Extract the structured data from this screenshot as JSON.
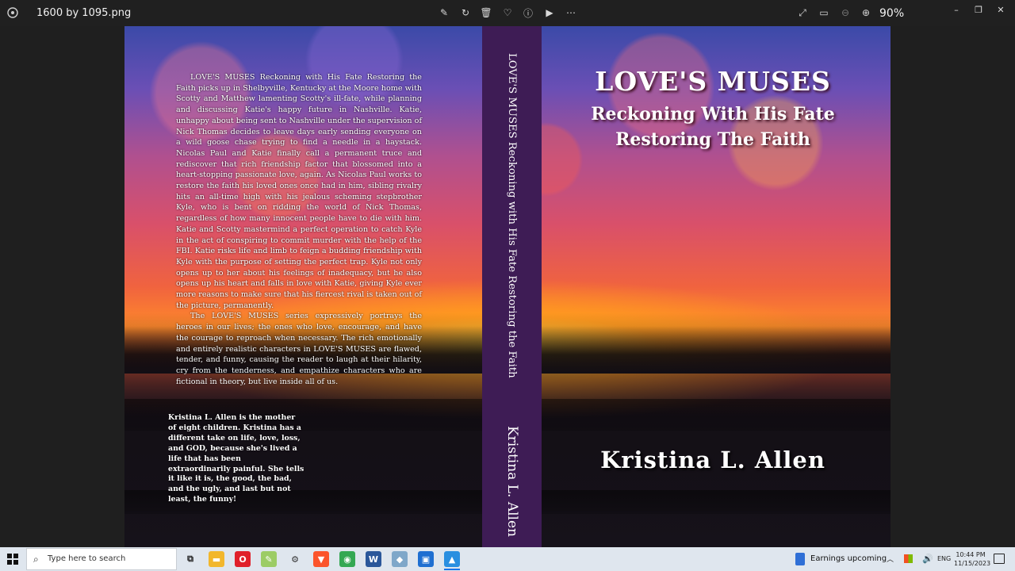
{
  "window": {
    "file_name": "1600  by  1095.png",
    "zoom_level": "90%",
    "toolbar_icons": [
      "edit-icon",
      "rotate-icon",
      "delete-icon",
      "favorite-icon",
      "info-icon",
      "slideshow-icon",
      "more-icon"
    ],
    "right_icons": [
      "fullscreen-icon",
      "fit-icon",
      "zoom-out-icon",
      "zoom-in-icon"
    ],
    "controls": {
      "minimize": "–",
      "restore": "❐",
      "close": "✕"
    }
  },
  "book": {
    "back_blurb": [
      "LOVE'S MUSES Reckoning with His Fate Restoring the Faith picks up in Shelbyville, Kentucky at the Moore home with Scotty and Matthew lamenting Scotty's ill-fate, while planning and discussing Katie's happy future in Nashville. Katie, unhappy about being sent to Nashville under the supervision of Nick Thomas decides to leave days early sending everyone on a wild goose chase trying to find a needle in a haystack. Nicolas Paul and Katie finally call a permanent truce and rediscover that rich friendship factor that blossomed into a heart-stopping passionate love, again. As Nicolas Paul works to restore the faith his loved ones once had in him, sibling rivalry hits an all-time high with his jealous scheming stepbrother Kyle, who is bent on ridding the world of Nick Thomas, regardless of how many innocent people have to die with him. Katie and Scotty mastermind a perfect operation to catch Kyle in the act of conspiring to commit murder with the help of the FBI. Katie risks life and limb to feign a budding friendship with Kyle with the purpose of setting the perfect trap. Kyle not only opens up to her about his feelings of inadequacy, but he also opens up his heart and falls in love with Katie, giving Kyle ever more reasons to make sure that his fiercest rival is taken out of the picture, permanently.",
      "The LOVE'S MUSES series expressively portrays the heroes in our lives; the ones who love, encourage, and have the courage to reproach when necessary. The rich emotionally and entirely realistic characters in LOVE'S MUSES are flawed, tender, and funny, causing the reader to laugh at their hilarity, cry from the tenderness, and empathize characters who are fictional in theory, but live inside all of us."
    ],
    "author_bio": "Kristina L. Allen is the mother of eight children. Kristina has a different take on life, love, loss, and GOD, because she's lived a life that has been extraordinarily painful. She tells it like it is, the good, the bad, and the ugly, and last but not least, the funny!",
    "spine_title": "LOVE'S MUSES  Reckoning with His Fate Restoring the Faith",
    "spine_author": "Kristina L. Allen",
    "front_title": "LOVE'S MUSES",
    "front_subtitle_1": "Reckoning With His Fate",
    "front_subtitle_2": "Restoring The Faith",
    "front_author": "Kristina  L.  Allen",
    "colors": {
      "spine": "#3e1c55"
    }
  },
  "taskbar": {
    "search_placeholder": "Type here to search",
    "pinned_apps": [
      {
        "name": "task-view-icon",
        "glyph": "⧉",
        "color": "#dfe6ee",
        "fg": "#222"
      },
      {
        "name": "file-explorer-icon",
        "glyph": "▬",
        "color": "#f2b72c",
        "fg": "#fff"
      },
      {
        "name": "opera-icon",
        "glyph": "O",
        "color": "#e0202a",
        "fg": "#fff"
      },
      {
        "name": "notes-app-icon",
        "glyph": "✎",
        "color": "#9ccc65",
        "fg": "#fff"
      },
      {
        "name": "settings-icon",
        "glyph": "⚙",
        "color": "#dfe6ee",
        "fg": "#333"
      },
      {
        "name": "brave-icon",
        "glyph": "▼",
        "color": "#fb542b",
        "fg": "#fff"
      },
      {
        "name": "chrome-icon",
        "glyph": "◉",
        "color": "#34a853",
        "fg": "#fff"
      },
      {
        "name": "word-icon",
        "glyph": "W",
        "color": "#2b579a",
        "fg": "#fff"
      },
      {
        "name": "app-icon-9",
        "glyph": "◆",
        "color": "#7fa7c9",
        "fg": "#fff"
      },
      {
        "name": "screen-recorder-icon",
        "glyph": "▣",
        "color": "#1f6fd1",
        "fg": "#fff"
      },
      {
        "name": "photos-icon",
        "glyph": "▲",
        "color": "#2a8fe0",
        "fg": "#fff"
      }
    ],
    "news": "Earnings upcoming",
    "language": "ENG",
    "time": "10:44 PM",
    "date": "11/15/2023"
  }
}
